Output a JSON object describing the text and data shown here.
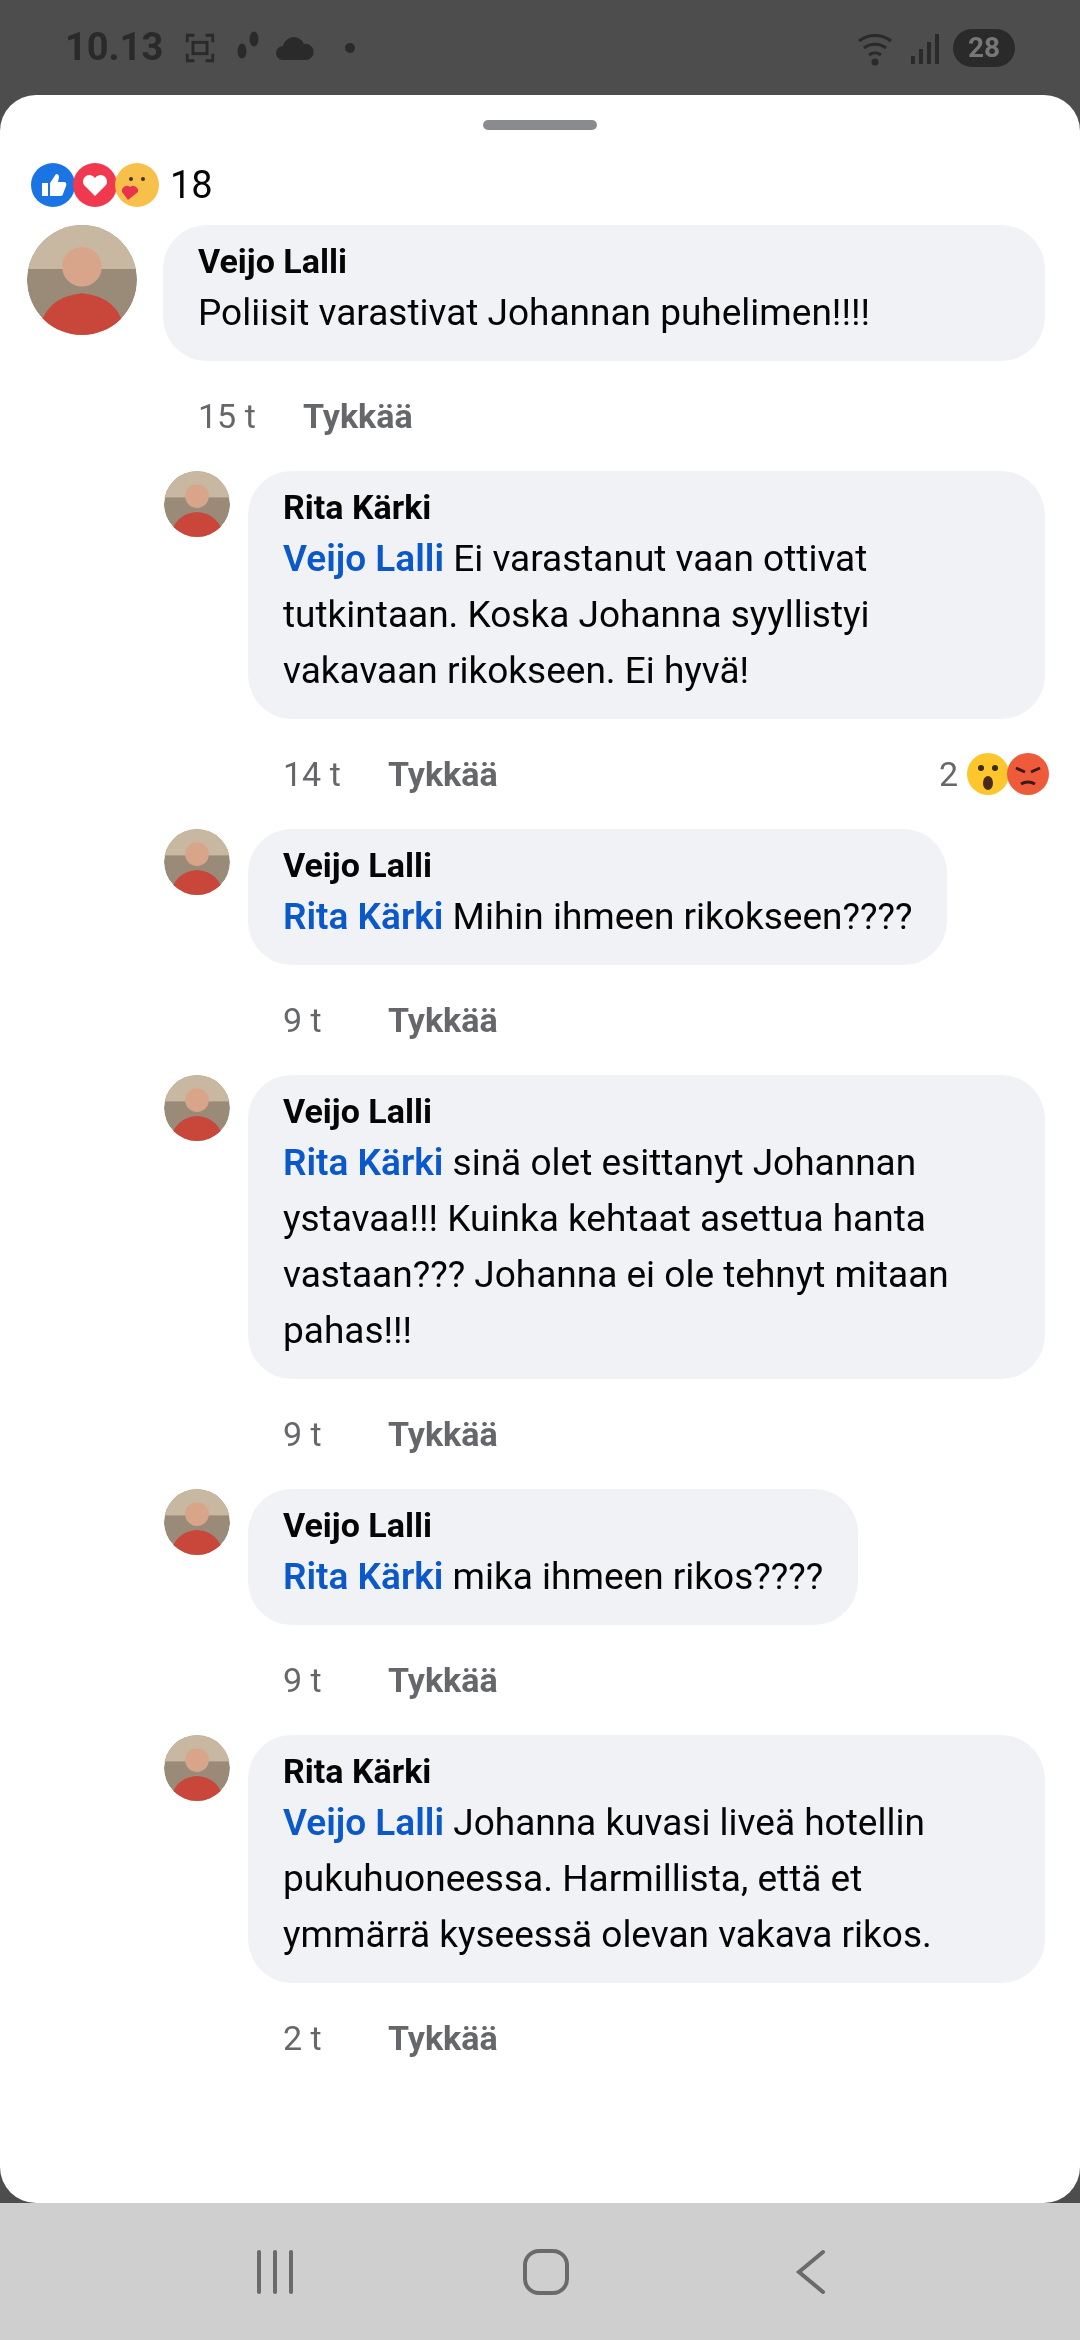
{
  "status_bar": {
    "time": "10.13",
    "battery": "28"
  },
  "reactions": {
    "count": "18"
  },
  "comments": [
    {
      "author": "Veijo Lalli",
      "text": "Poliisit varastivat Johannan puhelimen!!!!",
      "time": "15 t",
      "like": "Tykkää",
      "children": [
        {
          "author": "Rita Kärki",
          "mention": "Veijo Lalli",
          "text": "Ei varastanut vaan ottivat tutkintaan. Koska Johanna syyllistyi vakavaan rikokseen. Ei hyvä!",
          "time": "14 t",
          "like": "Tykkää",
          "reaction_count": "2"
        },
        {
          "author": "Veijo Lalli",
          "mention": "Rita Kärki",
          "text": "Mihin ihmeen rikokseen????",
          "time": "9 t",
          "like": "Tykkää"
        },
        {
          "author": "Veijo Lalli",
          "mention": "Rita Kärki",
          "text": "sinä olet esittanyt Johannan ystavaa!!! Kuinka kehtaat asettua hanta vastaan??? Johanna ei ole tehnyt mitaan pahas!!!",
          "time": "9 t",
          "like": "Tykkää"
        },
        {
          "author": "Veijo Lalli",
          "mention": "Rita Kärki",
          "text": "mika ihmeen rikos????",
          "time": "9 t",
          "like": "Tykkää"
        },
        {
          "author": "Rita Kärki",
          "mention": "Veijo Lalli",
          "text": "Johanna kuvasi liveä hotellin pukuhuoneessa. Harmillista, että et ymmärrä kyseessä olevan vakava rikos.",
          "time": "2 t",
          "like": "Tykkää"
        }
      ]
    }
  ]
}
